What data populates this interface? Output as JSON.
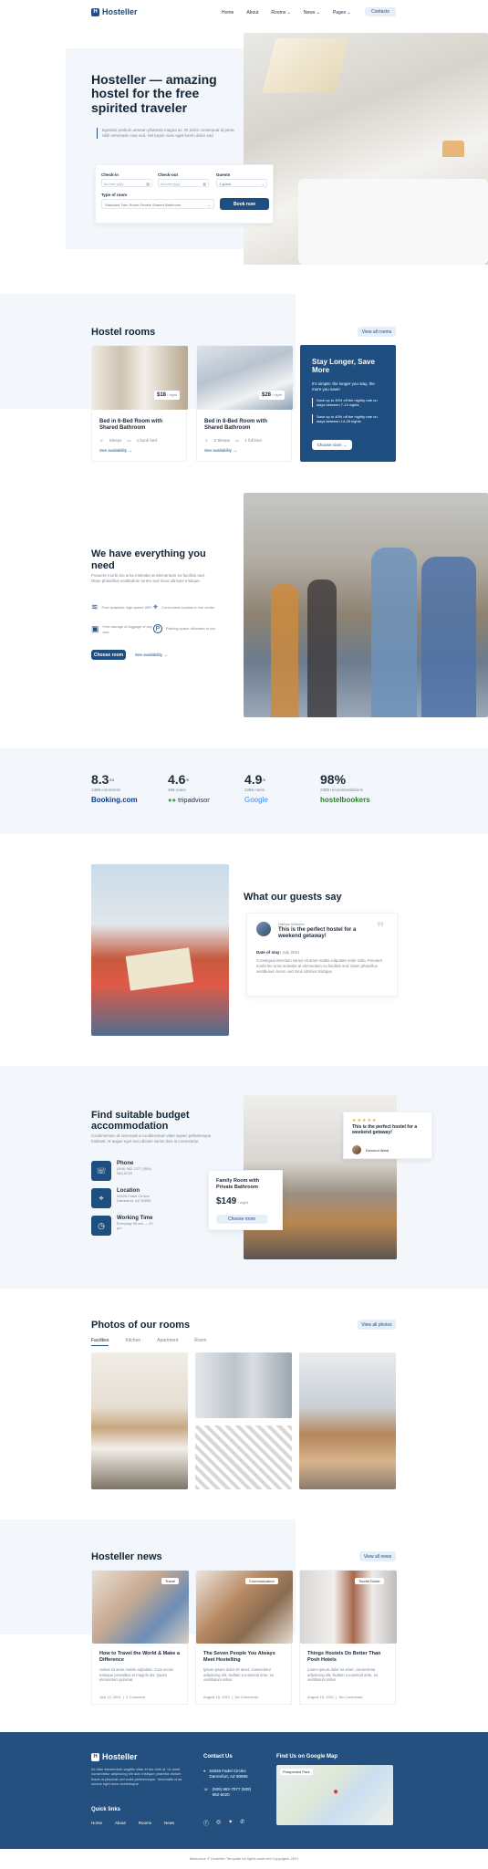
{
  "header": {
    "logo_text": "Hosteller",
    "nav": [
      "Home",
      "About",
      "Rooms ⌄",
      "News ⌄",
      "Pages ⌄"
    ],
    "contacts_label": "Contacts"
  },
  "hero": {
    "title": "Hosteller — amazing hostel for the free spirited traveler",
    "text": "Egestas pretium aenean pharetra magna ac. Et tortor consequat id porta nibh venenatis cras sed. Vel turpis nunc eget lorem dolor sed",
    "checkin_label": "Check-in",
    "checkin_placeholder": "dd.mm.yyyy",
    "checkout_label": "Check-out",
    "checkout_placeholder": "dd.mm.yyyy",
    "guests_label": "Guests",
    "guests_value": "1 guest",
    "room_type_label": "Type of room",
    "room_type_value": "Standard Twin Room Private Shared Bathroom",
    "book_label": "Book now"
  },
  "rooms": {
    "title": "Hostel rooms",
    "view_all": "View all rooms",
    "items": [
      {
        "price": "$18",
        "per": "/ night",
        "name": "Bed in 6-Bed Room with Shared Bathroom",
        "sleeps": "Sleeps",
        "beds": "1 bunk bed",
        "link": "See availability →"
      },
      {
        "price": "$28",
        "per": "/ night",
        "name": "Bed in 8-Bed Room with Shared Bathroom",
        "sleeps": "2 Sleeps",
        "beds": "1 full bed",
        "link": "See availability →"
      }
    ],
    "promo": {
      "title": "Stay Longer, Save More",
      "text": "It's simple: the longer you stay, the more you save!",
      "line1": "Save up to 30% off the nightly rate on stays between 7-14 nights",
      "line2": "Save up to 40% off the nightly rate on stays between 14-28 nights",
      "button": "Choose room →"
    }
  },
  "features": {
    "title": "We have everything you need",
    "text": "Posuere morbi leo urna molestie at elementum eu facilisis sed. Diam phasellus vestibulum lorem sed risus ultricies tristique.",
    "items": [
      "Free available high speed WiFi",
      "Convenient location in the center",
      "Free storage of luggage of any size",
      "Parking space allocated to you"
    ],
    "choose_label": "Choose room",
    "availability_label": "See availability →"
  },
  "ratings": [
    {
      "score": "8.3",
      "scale": "/10",
      "count": "1398 comments",
      "brand": "Booking.com"
    },
    {
      "score": "4.6",
      "scale": "/5",
      "count": "486 notes",
      "brand": "tripadvisor"
    },
    {
      "score": "4.9",
      "scale": "/5",
      "count": "2389 notes",
      "brand": "Google"
    },
    {
      "score": "98%",
      "scale": "",
      "count": "2389 recommendations",
      "brand": "hostelbookers"
    }
  ],
  "testimonial": {
    "title": "What our guests say",
    "author": "Nathan Wheeler",
    "quote_title": "This is the perfect hostel for a weekend getaway!",
    "date_label": "Date of stay:",
    "date": "July 2021",
    "text": "Consequat interdum varius sit amet mattis vulputate enim nulla. Posuere morbi leo urna molestie at elementum eu facilisis sed. Diam phasellus vestibulum lorem sed risus ultricies tristique."
  },
  "budget": {
    "title": "Find suitable budget accommodation",
    "text": "Condimentum id venenatis a condimentum vitae sapien pellentesque habitant. At augue eget arcu dictum varius duis at consectetur.",
    "phone_label": "Phone",
    "phone_lines": "(509) 982-7077 (509) 982-5020",
    "location_label": "Location",
    "location_lines": "54826 Fadel Circles Darrenfurt, AZ 90995",
    "hours_label": "Working Time",
    "hours_lines": "Everyday 09 am — 20 pm",
    "card_title": "Family Room with Private Bathroom",
    "card_price": "$149",
    "card_per": "/ night",
    "card_button": "Choose room",
    "review_title": "This is the perfect hostel for a weekend getaway!",
    "review_author": "Esmond Ward",
    "stars": "★★★★★"
  },
  "gallery": {
    "title": "Photos of our rooms",
    "view_all": "View all photos",
    "tabs": [
      "Facilities",
      "Kitchen",
      "Apartment",
      "Room"
    ]
  },
  "news": {
    "title": "Hosteller news",
    "view_all": "View all news",
    "items": [
      {
        "tag": "Travel",
        "title": "How to Travel the World & Make a Difference",
        "text": "Varius sit amet mattis vulputate. Cum sociis natoque penatibus et magnis dis. Quam elementum pulvinar.",
        "date": "July 12, 2021",
        "comments": "1 Comment"
      },
      {
        "tag": "Communication",
        "title": "The Seven People You Always Meet Hostelling",
        "text": "Ipsum ipsum dolor sit amet, consectetur adipiscing elit. Nullam a euismod ante, eu vestibulum tellus.",
        "date": "August 15, 2021",
        "comments": "No Comments"
      },
      {
        "tag": "Tourist Guide",
        "title": "Things Hostels Do Better Than Posh Hotels",
        "text": "Lorem ipsum dolor sit amet, consectetur adipiscing elit. Nullam a euismod ante, eu vestibulum tellus.",
        "date": "August 15, 2021",
        "comments": "No Comments"
      }
    ]
  },
  "footer": {
    "logo_text": "Hosteller",
    "text": "At vitae elementum sagittis vitae et leo duis ut. Ut amet consectetur adipiscing elit duis tristique pharetra dictum fusce ut placerat orci nulla pellentesque. Venenatis urna cursus eget nunc scelerisque.",
    "quick_links_title": "Quick links",
    "links": [
      "Home",
      "About",
      "Rooms",
      "News"
    ],
    "contact_title": "Contact Us",
    "address": "54826 Fadel Circles Darrenfurt, AZ 90995",
    "phones": "(509) 982-7077 (509) 982-5020",
    "map_title": "Find Us on Google Map",
    "map_label": "Prospected Park",
    "copyright": "Merkulove © Hosteller Template All rights reserved Copyrights 2021"
  }
}
